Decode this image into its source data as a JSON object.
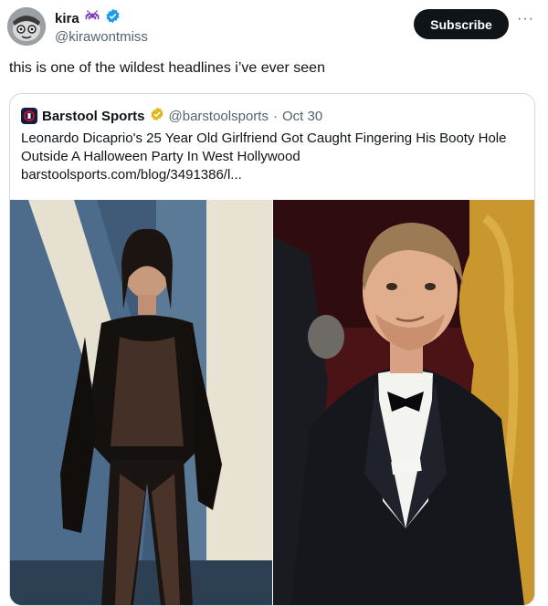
{
  "author": {
    "display_name": "kira",
    "handle": "@kirawontmiss"
  },
  "subscribe_label": "Subscribe",
  "more_label": "···",
  "tweet_text": "this is one of the wildest headlines i’ve ever seen",
  "quoted": {
    "name": "Barstool Sports",
    "handle": "@barstoolsports",
    "separator": "·",
    "date": "Oct 30",
    "headline": "Leonardo Dicaprio's 25 Year Old Girlfriend Got Caught Fingering His Booty Hole Outside A Halloween Party In West Hollywood",
    "link": "barstoolsports.com/blog/3491386/l..."
  },
  "icons": {
    "verified": "verified-badge-icon",
    "gold_verified": "gold-verified-badge-icon",
    "emoji": "space-invader-icon"
  },
  "colors": {
    "verified_blue": "#1d9bf0",
    "gold_badge": "#e2b719",
    "button_bg": "#0f1419",
    "secondary_text": "#536471",
    "emoji_purple": "#7b3fbf"
  }
}
